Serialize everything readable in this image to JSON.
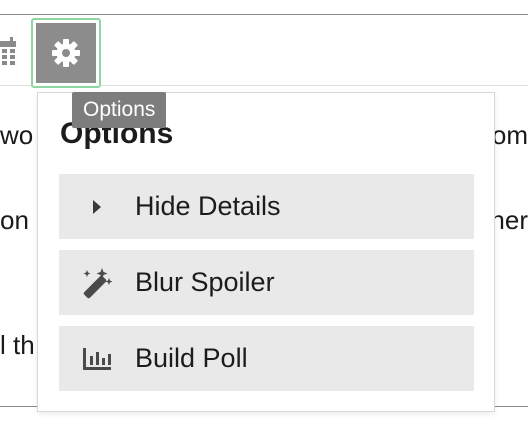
{
  "toolbar": {
    "calendar_icon": "calendar-icon",
    "gear_icon": "gear-icon",
    "gear_focus_color": "#8fd6a2"
  },
  "background_text": {
    "line1_left": "wo",
    "line1_right": "om",
    "line2_left": "on a",
    "line2_right": "ner",
    "line3_left": "l th"
  },
  "tooltip": {
    "text": "Options"
  },
  "popover": {
    "title": "Options",
    "items": [
      {
        "label": "Hide Details",
        "icon": "caret-right-icon"
      },
      {
        "label": "Blur Spoiler",
        "icon": "magic-wand-icon"
      },
      {
        "label": "Build Poll",
        "icon": "poll-icon"
      }
    ]
  },
  "colors": {
    "menu_item_bg": "#e9e9e9",
    "tooltip_bg": "#7d7d7d",
    "gear_bg": "#8c8c8c"
  }
}
